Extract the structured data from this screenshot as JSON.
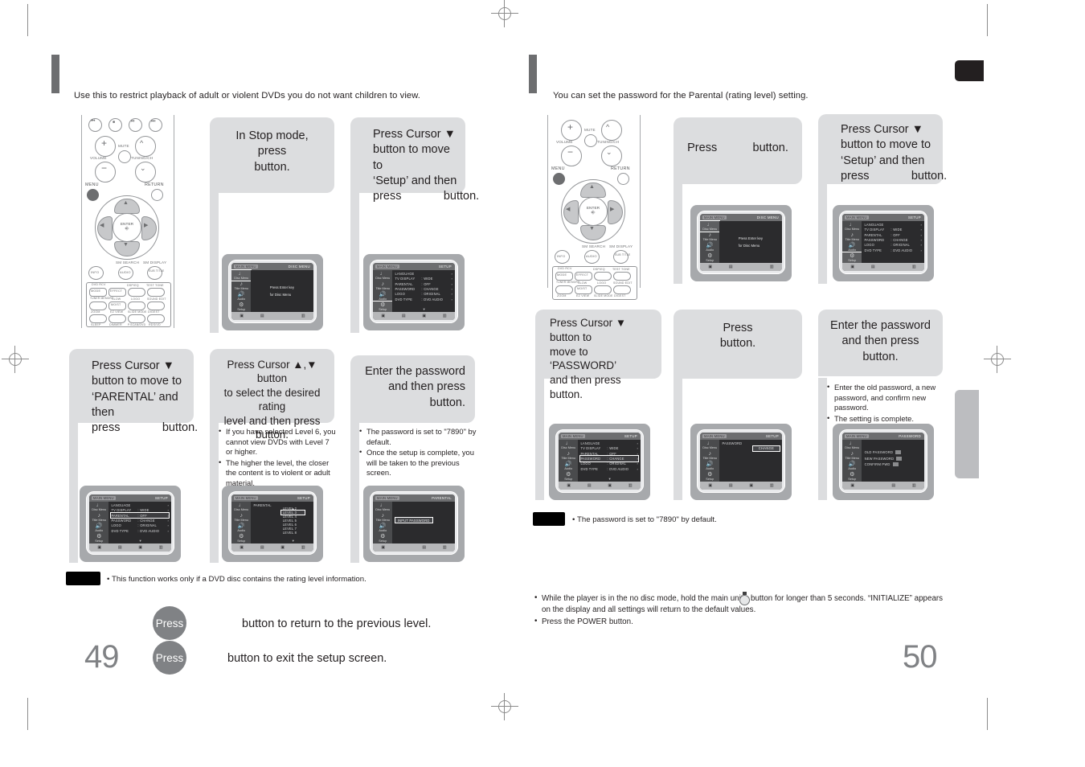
{
  "document": {
    "left_page_number": "49",
    "right_page_number": "50"
  },
  "left_page": {
    "intro": "Use this to restrict playback of adult or violent DVDs you do not want children to view.",
    "steps": [
      {
        "id": "step1",
        "lines": [
          "In Stop mode,",
          "press",
          "button."
        ],
        "screen": {
          "title_left": "MAIN MENU",
          "title_right": "DISC MENU",
          "sidebar": [
            "Disc Menu",
            "Title Menu",
            "Audio",
            "Setup"
          ],
          "selected_sidebar": "Disc Menu",
          "center_text": [
            "Press Enter key",
            "for Disc Menu"
          ]
        }
      },
      {
        "id": "step2",
        "lines": [
          "Press Cursor ▼",
          "button to move to",
          "‘Setup’ and then",
          "press             button."
        ],
        "screen": {
          "title_left": "MAIN MENU",
          "title_right": "SETUP",
          "sidebar": [
            "Disc Menu",
            "Title Menu",
            "Audio",
            "Setup"
          ],
          "selected_sidebar": "Setup",
          "rows": [
            {
              "name": "LANGUAGE",
              "value": "",
              "arrow": "›"
            },
            {
              "name": "TV  DISPLAY",
              "value": "WIDE",
              "arrow": "›"
            },
            {
              "name": "PARENTAL",
              "value": "OFF",
              "arrow": "›"
            },
            {
              "name": "PASSWORD",
              "value": "CHANGE",
              "arrow": "›"
            },
            {
              "name": "LOGO",
              "value": "ORIGINAL",
              "arrow": "›"
            },
            {
              "name": "DVD TYPE",
              "value": "DVD AUDIO",
              "arrow": "›"
            }
          ],
          "highlighted_row": -1
        }
      },
      {
        "id": "step3",
        "lines": [
          "Press Cursor ▼",
          "button to move to",
          "‘PARENTAL’ and then",
          "press             button."
        ],
        "screen": {
          "title_left": "MAIN MENU",
          "title_right": "SETUP",
          "sidebar": [
            "Disc Menu",
            "Title Menu",
            "Audio",
            "Setup"
          ],
          "rows": [
            {
              "name": "LANGUAGE",
              "value": "",
              "arrow": "›"
            },
            {
              "name": "TV  DISPLAY",
              "value": "WIDE",
              "arrow": "›"
            },
            {
              "name": "PARENTAL",
              "value": "OFF",
              "arrow": "›"
            },
            {
              "name": "PASSWORD",
              "value": "CHANGE",
              "arrow": "›"
            },
            {
              "name": "LOGO",
              "value": "ORIGINAL",
              "arrow": "›"
            },
            {
              "name": "DVD TYPE",
              "value": "DVD AUDIO",
              "arrow": "›"
            }
          ],
          "highlighted_row": 2
        }
      },
      {
        "id": "step4",
        "lines": [
          "Press Cursor ▲,▼ button",
          "to select the desired rating",
          "level and then press",
          "button."
        ],
        "notes": [
          "If you have selected Level 6, you cannot view DVDs with Level 7 or higher.",
          "The higher the level, the closer the content is to violent or adult material."
        ],
        "screen": {
          "title_left": "MAIN MENU",
          "title_right": "SETUP",
          "sidebar": [
            "Disc Menu",
            "Title Menu",
            "Audio",
            "Setup"
          ],
          "label": "PARENTAL",
          "levels": [
            "LEVEL 2",
            "LEVEL 3",
            "LEVEL 4",
            "LEVEL 5",
            "LEVEL 6",
            "LEVEL 7",
            "LEVEL 8"
          ],
          "highlighted_level": 1
        }
      },
      {
        "id": "step5",
        "lines": [
          "Enter the password",
          "and then press",
          "button."
        ],
        "notes": [
          "The password is set to \"7890\" by default.",
          "Once the setup is complete, you will be taken to the previous screen."
        ],
        "screen": {
          "title_left": "MAIN MENU",
          "title_right": "PARENTAL",
          "sidebar": [
            "Disc Menu",
            "Title Menu",
            "Audio",
            "Setup"
          ],
          "input_label": "INPUT PASSWORD"
        }
      }
    ],
    "note": {
      "chip_label": "NOTE",
      "text": "This function works only if a DVD disc contains the rating level information."
    },
    "footer": [
      {
        "press_label": "Press",
        "text": "button to return to the previous level."
      },
      {
        "press_label": "Press",
        "text": "button to exit the setup screen."
      }
    ]
  },
  "right_page": {
    "intro": "You can set the password for the Parental (rating level) setting.",
    "steps": [
      {
        "id": "rstep1",
        "lines": [
          "Press           button."
        ],
        "screen": {
          "title_left": "MAIN MENU",
          "title_right": "DISC MENU",
          "sidebar": [
            "Disc Menu",
            "Title Menu",
            "Audio",
            "Setup"
          ],
          "selected_sidebar": "Disc Menu",
          "center_text": [
            "Press Enter key",
            "for Disc Menu"
          ]
        }
      },
      {
        "id": "rstep2",
        "lines": [
          "Press Cursor ▼",
          "button to move to",
          "‘Setup’ and then",
          "press             button."
        ],
        "screen": {
          "title_left": "MAIN MENU",
          "title_right": "SETUP",
          "sidebar": [
            "Disc Menu",
            "Title Menu",
            "Audio",
            "Setup"
          ],
          "selected_sidebar": "Setup",
          "rows": [
            {
              "name": "LANGUAGE",
              "value": "",
              "arrow": "›"
            },
            {
              "name": "TV  DISPLAY",
              "value": "WIDE",
              "arrow": "›"
            },
            {
              "name": "PARENTAL",
              "value": "OFF",
              "arrow": "›"
            },
            {
              "name": "PASSWORD",
              "value": "CHANGE",
              "arrow": "›"
            },
            {
              "name": "LOGO",
              "value": "ORIGINAL",
              "arrow": "›"
            },
            {
              "name": "DVD TYPE",
              "value": "DVD AUDIO",
              "arrow": "›"
            }
          ],
          "highlighted_row": -1
        }
      },
      {
        "id": "rstep3",
        "lines": [
          "Press Cursor ▼ button to",
          "move to ‘PASSWORD’",
          "and then press",
          "button."
        ],
        "screen": {
          "title_left": "MAIN MENU",
          "title_right": "SETUP",
          "sidebar": [
            "Disc Menu",
            "Title Menu",
            "Audio",
            "Setup"
          ],
          "rows": [
            {
              "name": "LANGUAGE",
              "value": "",
              "arrow": "›"
            },
            {
              "name": "TV  DISPLAY",
              "value": "WIDE",
              "arrow": "›"
            },
            {
              "name": "PARENTAL",
              "value": "OFF",
              "arrow": "›"
            },
            {
              "name": "PASSWORD",
              "value": "CHANGE",
              "arrow": "›"
            },
            {
              "name": "LOGO",
              "value": "ORIGINAL",
              "arrow": "›"
            },
            {
              "name": "DVD TYPE",
              "value": "DVD AUDIO",
              "arrow": "›"
            }
          ],
          "highlighted_row": 3
        }
      },
      {
        "id": "rstep4",
        "lines": [
          "Press",
          "button."
        ],
        "screen": {
          "title_left": "MAIN MENU",
          "title_right": "SETUP",
          "sidebar": [
            "Disc Menu",
            "Title Menu",
            "Audio",
            "Setup"
          ],
          "label": "PASSWORD",
          "change_value": "CHANGE"
        }
      },
      {
        "id": "rstep5",
        "lines": [
          "Enter the password",
          "and then press",
          "button."
        ],
        "notes": [
          "Enter the old password, a new password, and confirm new password.",
          "The setting is complete."
        ],
        "screen": {
          "title_left": "MAIN MENU",
          "title_right": "PASSWORD",
          "sidebar": [
            "Disc Menu",
            "Title Menu",
            "Audio",
            "Setup"
          ],
          "fields": [
            "OLD PASSWORD",
            "NEW PASSWORD",
            "CONFIRM PWD"
          ]
        }
      }
    ],
    "note": {
      "chip_label": "NOTE",
      "text": "The password is set to \"7890\" by default."
    },
    "bottom_notes": [
      "While the player is in the no disc mode, hold the main unit's        button for longer than 5 seconds. “INITIALIZE” appears on the display and all settings will return to the default values.",
      "Press the POWER button."
    ]
  },
  "remote": {
    "labels": {
      "volume": "VOLUME",
      "mute": "MUTE",
      "tuning": "TUNING/CH",
      "menu": "MENU",
      "return": "RETURN",
      "enter": "ENTER",
      "sm_search": "SM SEARCH",
      "sm_display": "SM DISPLAY",
      "info": "INFO",
      "audio": "AUDIO",
      "subtitle": "SUB TITLE",
      "mode": "MODE",
      "effect": "EFFECT",
      "dimmer_top": "DSP/EQ",
      "test_tone": "TEST TONE",
      "tuner_memory": "TUNER MEMORY",
      "slow": "SLOW",
      "logo": "LOGO",
      "sound_edit": "SOUND EDIT",
      "movet": "MO/ST",
      "zoom": "ZOOM",
      "ez_view": "EZ VIEW",
      "slide_mode": "SLIDE MODE",
      "digest": "DIGEST",
      "sleep": "SLEEP",
      "dimmer": "DIMMER",
      "p_scan": "P.SCAN/DVD",
      "dvd_rcv": "RDS/VD",
      "select": "SELECT",
      "dvd_rcv_group": "DVD RCV"
    }
  },
  "colors": {
    "balloon_bg": "#dcdddf",
    "section_bar": "#6d6e70",
    "page_number": "#808285",
    "press_circle": "#808285",
    "tab_black": "#231f20",
    "tab_gray": "#bcbdc0"
  }
}
